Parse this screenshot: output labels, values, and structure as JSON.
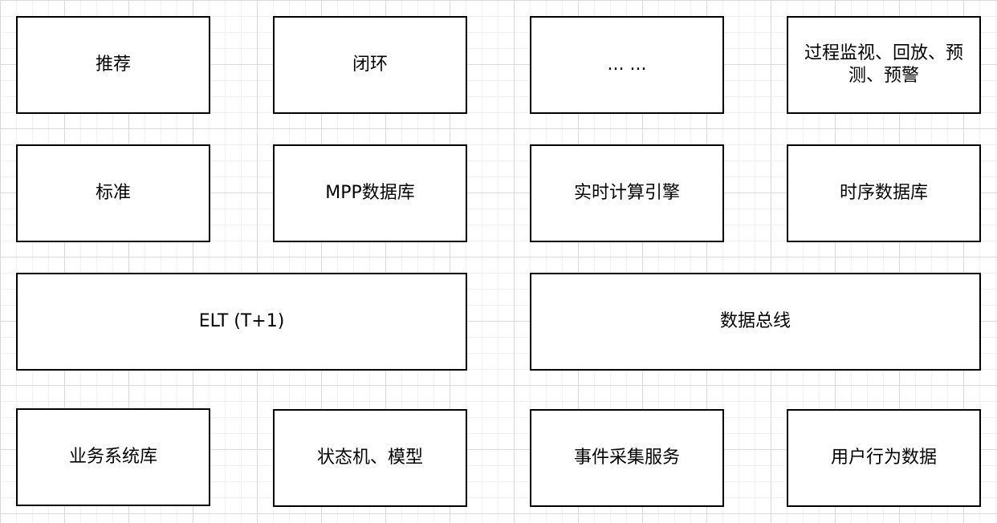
{
  "diagram": {
    "row1": {
      "recommend": "推荐",
      "closed_loop": "闭环",
      "ellipsis": "... ...",
      "monitor": "过程监视、回放、预测、预警"
    },
    "row2": {
      "standard": "标准",
      "mpp_db": "MPP数据库",
      "realtime_engine": "实时计算引擎",
      "timeseries_db": "时序数据库"
    },
    "row3": {
      "elt": "ELT (T+1)",
      "data_bus": "数据总线"
    },
    "row4": {
      "business_db": "业务系统库",
      "state_machine_model": "状态机、模型",
      "event_collection": "事件采集服务",
      "user_behavior_data": "用户行为数据"
    }
  }
}
